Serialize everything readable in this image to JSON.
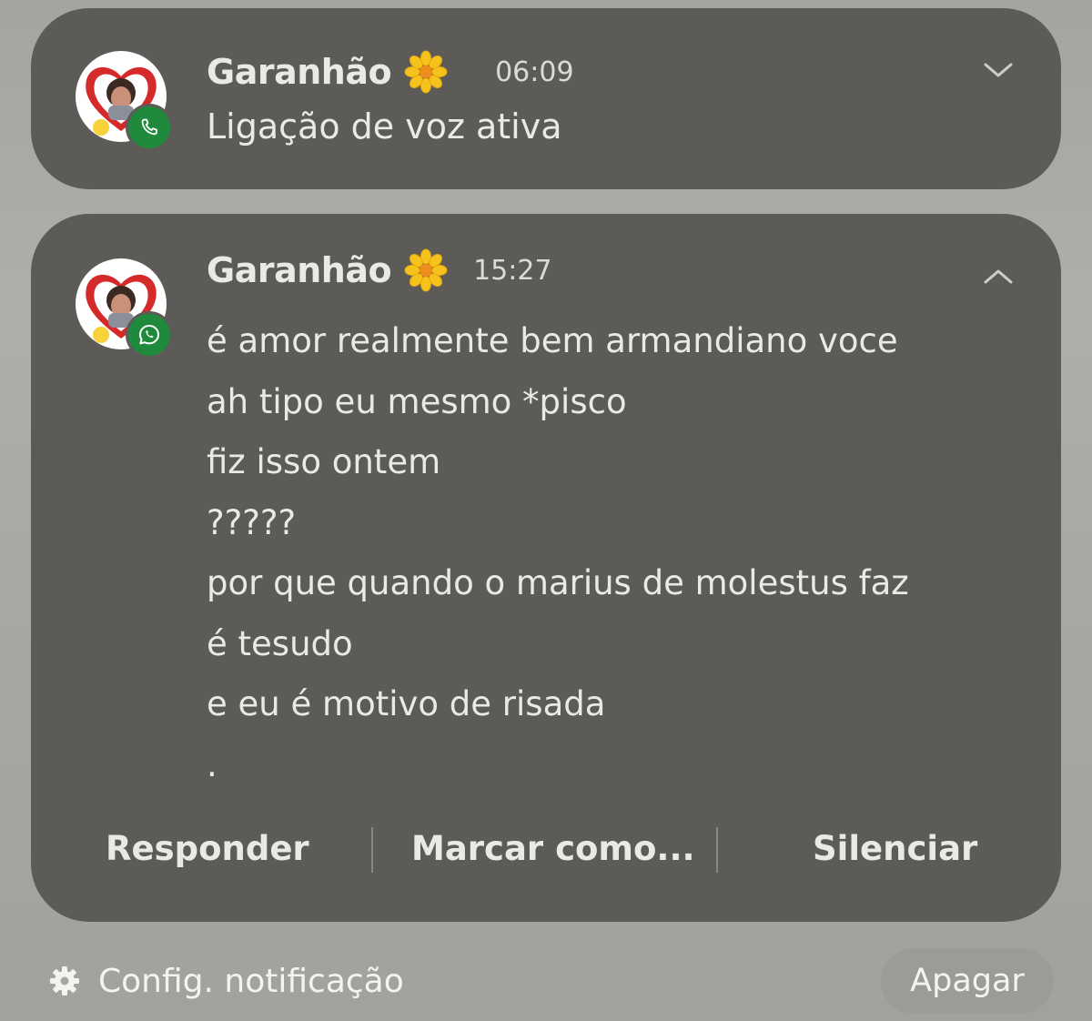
{
  "notifications": [
    {
      "sender": "Garanhão",
      "time": "06:09",
      "app_badge_icon": "phone-icon",
      "text": "Ligação de voz ativa",
      "chevron_icon": "chevron-down-icon"
    },
    {
      "sender": "Garanhão",
      "time": "15:27",
      "app_badge_icon": "whatsapp-icon",
      "chevron_icon": "chevron-up-icon",
      "messages": [
        "é amor realmente bem armandiano voce",
        "ah tipo eu mesmo *pisco",
        "fiz isso ontem",
        "?????",
        "por que quando o marius de molestus faz",
        "é tesudo",
        "e eu é motivo de risada",
        "."
      ],
      "actions": {
        "reply": "Responder",
        "mark": "Marcar como...",
        "mute": "Silenciar"
      }
    }
  ],
  "footer": {
    "settings_label": "Config. notificação",
    "clear_label": "Apagar"
  },
  "colors": {
    "card_background": "#5c5b57",
    "badge_green": "#1f8a3b",
    "flower_yellow": "#f6c21c",
    "avatar_heart": "#d42a2a"
  }
}
